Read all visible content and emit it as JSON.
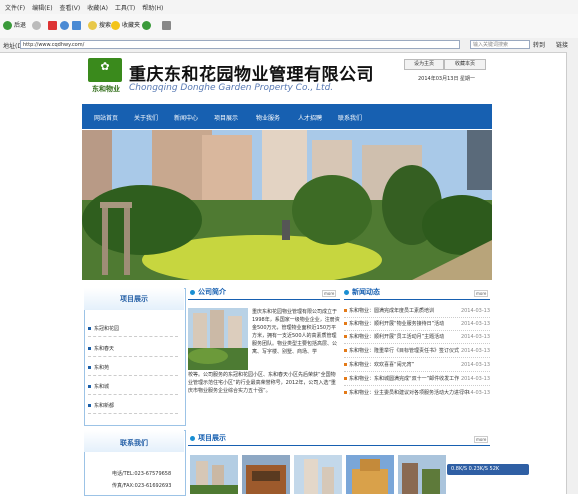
{
  "browser": {
    "menu": [
      "文件(F)",
      "编辑(E)",
      "查看(V)",
      "收藏(A)",
      "工具(T)",
      "帮助(H)"
    ],
    "back_label": "后退",
    "search_label": "搜索",
    "favorites_label": "收藏夹",
    "address_label": "地址(D)",
    "url": "http://www.cqdhwy.com/",
    "search_placeholder": "输入关键词搜索",
    "go_label": "转到",
    "links_label": "链接"
  },
  "header": {
    "logo_text": "东和物业",
    "company_cn": "重庆东和花园物业管理有限公司",
    "company_en": "Chongqing Donghe Garden Property Co., Ltd.",
    "set_home": "设为主页",
    "add_favorite": "收藏本页",
    "date": "2014年03月13日 星期一"
  },
  "nav": [
    "网站首页",
    "关于我们",
    "新闻中心",
    "项目展示",
    "物业服务",
    "人才招聘",
    "联系我们"
  ],
  "sidebar": {
    "title": "项目展示",
    "items": [
      "东冠和花园",
      "东和春天",
      "东和苑",
      "东和城",
      "东和新都"
    ]
  },
  "contact": {
    "title": "联系我们",
    "lines": [
      "电话/TEL:023-67579658",
      "传真/FAX:023-61692693"
    ]
  },
  "intro": {
    "title": "公司简介",
    "more": "more",
    "text_side": "重庆东和花园物业管理有限公司成立于1998年，系国家一级物业企业，注册资金500万元，管理物业面积近150万平方米，拥有一支近500人的高素质管理服务团队。物业类型主要包括高层、公寓、写字楼、别墅、商场、学",
    "text_bottom": "校等。公司服务的东冠和花园小区、东和春天小区先后荣获“全国物业管理示范住宅小区”的行业最高荣誉称号，2012年，公司入选“重庆市物业服务企业综合实力五十强”。"
  },
  "news": {
    "title": "新闻动态",
    "more": "more",
    "items": [
      {
        "title": "东和物业：圆满完成年度员工素质培训",
        "date": "2014-03-13"
      },
      {
        "title": "东和物业：顺利开展“物业服务接待日”活动",
        "date": "2014-03-13"
      },
      {
        "title": "东和物业：顺利开展“员工活动月”主题活动",
        "date": "2014-03-13"
      },
      {
        "title": "东和物业：隆重举行《目标管理责任书》签订仪式",
        "date": "2014-03-13"
      },
      {
        "title": "东和物业：欢欢喜喜“闹元宵”",
        "date": "2014-03-13"
      },
      {
        "title": "东和物业：东和城圆满完成“双十一”邮件收发工作",
        "date": "2014-03-13"
      },
      {
        "title": "东和物业：业主委员和建议对各项服务活动大力进行中",
        "date": "2014-03-13"
      }
    ]
  },
  "projects": {
    "title": "项目展示",
    "more": "more"
  },
  "status": {
    "text": "0.8K/S  0.23K/S  52K"
  },
  "colors": {
    "nav_blue": "#1760b1",
    "logo_green": "#3a8a1c",
    "panel_border": "#9cc3e6"
  }
}
